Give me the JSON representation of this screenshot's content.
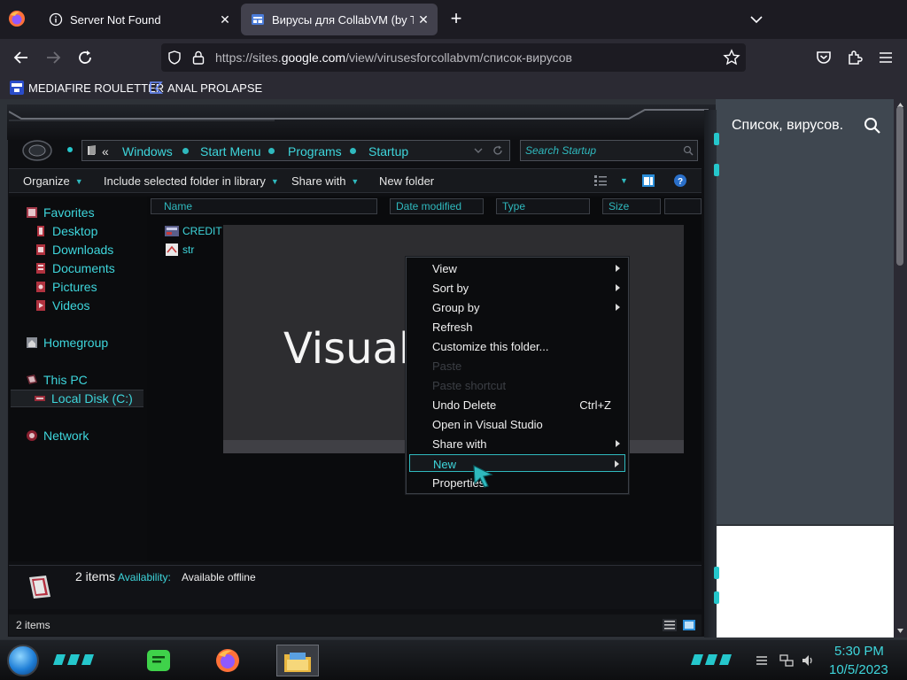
{
  "browser": {
    "tabs": [
      {
        "title": "Server Not Found",
        "active": false
      },
      {
        "title": "Вирусы для CollabVM (by TestD",
        "active": true
      }
    ],
    "new_tab_label": "+",
    "close_glyph": "✕",
    "url": {
      "prefix": "https://sites.",
      "host": "google.com",
      "path": "/view/virusesforcollabvm/список-вирусов"
    },
    "bookmarks": [
      {
        "label": "MEDIAFIRE ROULETTER",
        "icon": "mediafire-icon"
      },
      {
        "label": "ANAL PROLAPSE",
        "icon": "bookmark-icon"
      }
    ]
  },
  "page": {
    "title": "Список, вирусов.",
    "bottom_text": "...."
  },
  "explorer": {
    "breadcrumbs": [
      "Windows",
      "Start Menu",
      "Programs",
      "Startup"
    ],
    "breadcrumb_prefix": "«",
    "search_placeholder": "Search Startup",
    "toolbar": {
      "organize": "Organize",
      "include": "Include selected folder in library",
      "share": "Share with",
      "new_folder": "New folder"
    },
    "nav": {
      "favorites": "Favorites",
      "desktop": "Desktop",
      "downloads": "Downloads",
      "documents": "Documents",
      "pictures": "Pictures",
      "videos": "Videos",
      "homegroup": "Homegroup",
      "this_pc": "This PC",
      "local_disk": "Local Disk (C:)",
      "network": "Network"
    },
    "columns": [
      "Name",
      "Date modified",
      "Type",
      "Size"
    ],
    "files": [
      {
        "name": "CREDIT C"
      },
      {
        "name": "str"
      }
    ],
    "preview_text": "Visual",
    "details": {
      "count": "2 items",
      "availability_label": "Availability:",
      "availability_value": "Available offline"
    },
    "status": "2 items"
  },
  "context_menu": {
    "items": [
      {
        "label": "View",
        "submenu": true
      },
      {
        "label": "Sort by",
        "submenu": true
      },
      {
        "label": "Group by",
        "submenu": true
      },
      {
        "label": "Refresh"
      },
      {
        "label": "Customize this folder..."
      },
      {
        "label": "Paste",
        "disabled": true
      },
      {
        "label": "Paste shortcut",
        "disabled": true
      },
      {
        "label": "Undo Delete",
        "shortcut": "Ctrl+Z"
      },
      {
        "label": "Open in Visual Studio"
      },
      {
        "label": "Share with",
        "submenu": true
      },
      {
        "label": "New",
        "submenu": true,
        "highlighted": true
      },
      {
        "label": "Properties"
      }
    ]
  },
  "taskbar": {
    "time": "5:30 PM",
    "date": "10/5/2023"
  },
  "colors": {
    "accent": "#3ed6dc",
    "browser_bg": "#1c1b22",
    "toolbar_bg": "#2b2a33",
    "page_panel": "#3f4750"
  }
}
